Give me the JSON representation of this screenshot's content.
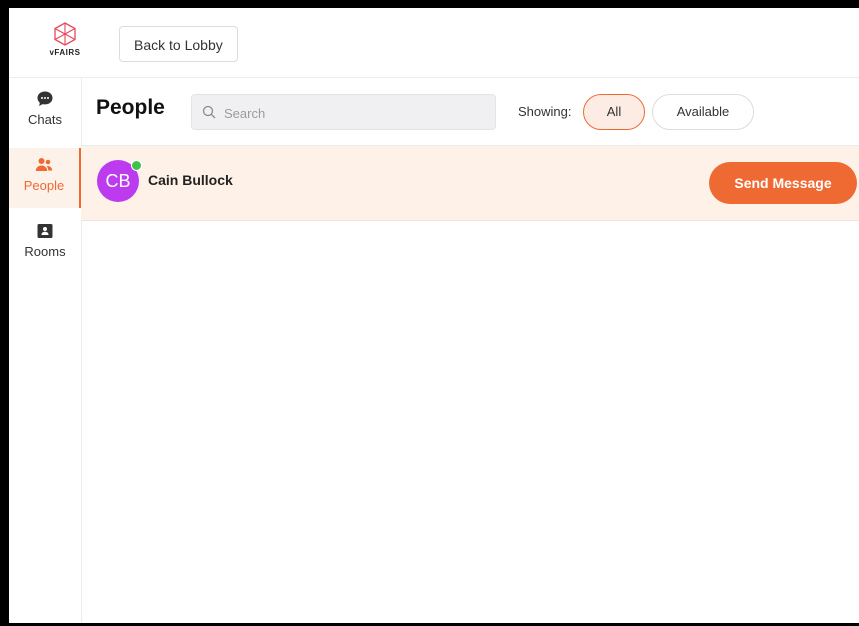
{
  "topbar": {
    "logo_text": "vFAIRS",
    "back_label": "Back to Lobby"
  },
  "sidebar": {
    "items": [
      {
        "label": "Chats",
        "icon": "chat-bubble-icon",
        "active": false
      },
      {
        "label": "People",
        "icon": "people-icon",
        "active": true
      },
      {
        "label": "Rooms",
        "icon": "rooms-icon",
        "active": false
      }
    ]
  },
  "header": {
    "title": "People",
    "search_placeholder": "Search",
    "search_value": "",
    "showing_label": "Showing:",
    "filters": [
      {
        "label": "All",
        "selected": true
      },
      {
        "label": "Available",
        "selected": false
      }
    ]
  },
  "people": [
    {
      "initials": "CB",
      "name": "Cain Bullock",
      "online": true,
      "action_label": "Send Message"
    }
  ],
  "colors": {
    "accent": "#ef6a33",
    "avatar": "#bc3bee",
    "online": "#3fc14a",
    "row_highlight": "#fdf1e8"
  }
}
